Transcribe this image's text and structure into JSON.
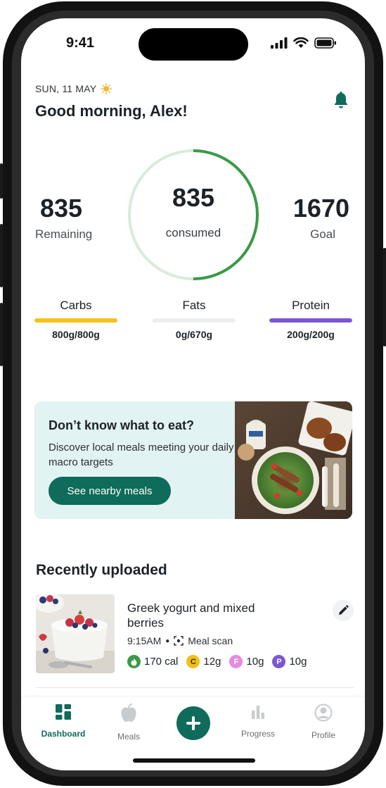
{
  "status": {
    "time": "9:41"
  },
  "header": {
    "date": "SUN, 11 MAY",
    "greeting": "Good morning, Alex!"
  },
  "summary": {
    "remaining_value": "835",
    "remaining_label": "Remaining",
    "consumed_value": "835",
    "consumed_label": "consumed",
    "goal_value": "1670",
    "goal_label": "Goal",
    "progress_fraction": 0.5
  },
  "macros": [
    {
      "label": "Carbs",
      "value": "800g/800g",
      "fill": 1.0,
      "color": "#f7c21a"
    },
    {
      "label": "Fats",
      "value": "0g/670g",
      "fill": 0.0,
      "color": "#cfcfcf"
    },
    {
      "label": "Protein",
      "value": "200g/200g",
      "fill": 1.0,
      "color": "#7b57d4"
    }
  ],
  "promo": {
    "title": "Don’t know what to eat?",
    "text": "Discover local meals meeting your daily macro targets",
    "button": "See nearby meals"
  },
  "recent": {
    "title": "Recently uploaded",
    "meal": {
      "name": "Greek yogurt and mixed berries",
      "time": "9:15AM",
      "source": "Meal scan",
      "calories": "170 cal",
      "carbs": "12g",
      "fats": "10g",
      "protein": "10g",
      "carbs_badge": "C",
      "fats_badge": "F",
      "protein_badge": "P"
    }
  },
  "tabs": [
    {
      "label": "Dashboard",
      "icon": "dashboard-icon",
      "active": true
    },
    {
      "label": "Meals",
      "icon": "apple-icon",
      "active": false
    },
    {
      "label": "Progress",
      "icon": "bar-chart-icon",
      "active": false
    },
    {
      "label": "Profile",
      "icon": "user-icon",
      "active": false
    }
  ],
  "colors": {
    "accent": "#0f6b5a",
    "ring": "#3a9a47",
    "ring_track": "#d7ecd9"
  }
}
